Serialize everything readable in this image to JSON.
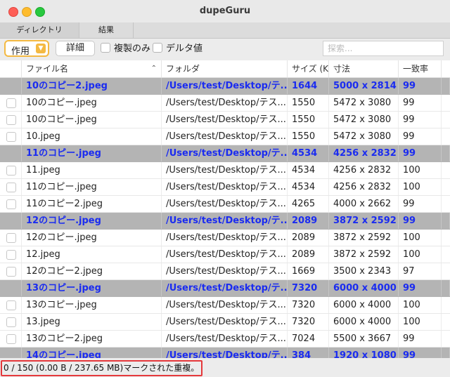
{
  "window": {
    "title": "dupeGuru"
  },
  "tabs": [
    {
      "label": "ディレクトリ"
    },
    {
      "label": "結果"
    }
  ],
  "toolbar": {
    "action_label": "作用",
    "detail_label": "詳細",
    "dupes_only_label": "複製のみ",
    "delta_label": "デルタ値",
    "search_placeholder": "探索..."
  },
  "columns": [
    "ファイル名",
    "フォルダ",
    "サイズ (K",
    "寸法",
    "一致率"
  ],
  "rows": [
    {
      "ref": true,
      "name": "10のコピー2.jpeg",
      "folder": "/Users/test/Desktop/テ...",
      "size": "1644",
      "dims": "5000 x 2814",
      "match": "99"
    },
    {
      "ref": false,
      "name": "10のコピー.jpeg",
      "folder": "/Users/test/Desktop/テス...",
      "size": "1550",
      "dims": "5472 x 3080",
      "match": "99"
    },
    {
      "ref": false,
      "name": "10のコピー.jpeg",
      "folder": "/Users/test/Desktop/テス...",
      "size": "1550",
      "dims": "5472 x 3080",
      "match": "99"
    },
    {
      "ref": false,
      "name": "10.jpeg",
      "folder": "/Users/test/Desktop/テス...",
      "size": "1550",
      "dims": "5472 x 3080",
      "match": "99"
    },
    {
      "ref": true,
      "name": "11のコピー.jpeg",
      "folder": "/Users/test/Desktop/テ...",
      "size": "4534",
      "dims": "4256 x 2832",
      "match": "99"
    },
    {
      "ref": false,
      "name": "11.jpeg",
      "folder": "/Users/test/Desktop/テス...",
      "size": "4534",
      "dims": "4256 x 2832",
      "match": "100"
    },
    {
      "ref": false,
      "name": "11のコピー.jpeg",
      "folder": "/Users/test/Desktop/テス...",
      "size": "4534",
      "dims": "4256 x 2832",
      "match": "100"
    },
    {
      "ref": false,
      "name": "11のコピー2.jpeg",
      "folder": "/Users/test/Desktop/テス...",
      "size": "4265",
      "dims": "4000 x 2662",
      "match": "99"
    },
    {
      "ref": true,
      "name": "12のコピー.jpeg",
      "folder": "/Users/test/Desktop/テ...",
      "size": "2089",
      "dims": "3872 x 2592",
      "match": "99"
    },
    {
      "ref": false,
      "name": "12のコピー.jpeg",
      "folder": "/Users/test/Desktop/テス...",
      "size": "2089",
      "dims": "3872 x 2592",
      "match": "100"
    },
    {
      "ref": false,
      "name": "12.jpeg",
      "folder": "/Users/test/Desktop/テス...",
      "size": "2089",
      "dims": "3872 x 2592",
      "match": "100"
    },
    {
      "ref": false,
      "name": "12のコピー2.jpeg",
      "folder": "/Users/test/Desktop/テス...",
      "size": "1669",
      "dims": "3500 x 2343",
      "match": "97"
    },
    {
      "ref": true,
      "name": "13のコピー.jpeg",
      "folder": "/Users/test/Desktop/テ...",
      "size": "7320",
      "dims": "6000 x 4000",
      "match": "99"
    },
    {
      "ref": false,
      "name": "13のコピー.jpeg",
      "folder": "/Users/test/Desktop/テス...",
      "size": "7320",
      "dims": "6000 x 4000",
      "match": "100"
    },
    {
      "ref": false,
      "name": "13.jpeg",
      "folder": "/Users/test/Desktop/テス...",
      "size": "7320",
      "dims": "6000 x 4000",
      "match": "100"
    },
    {
      "ref": false,
      "name": "13のコピー2.jpeg",
      "folder": "/Users/test/Desktop/テス...",
      "size": "7024",
      "dims": "5500 x 3667",
      "match": "99"
    },
    {
      "ref": true,
      "name": "14のコピー.jpeg",
      "folder": "/Users/test/Desktop/テ...",
      "size": "384",
      "dims": "1920 x 1080",
      "match": "99"
    }
  ],
  "status": {
    "text": "0 / 150 (0.00 B / 237.65 MB)マークされた重複。"
  },
  "colors": {
    "reference_text": "#1b2cf0",
    "reference_row_bg": "#b4b4b4",
    "action_accent": "#f4b942",
    "status_highlight": "#e5383b"
  }
}
